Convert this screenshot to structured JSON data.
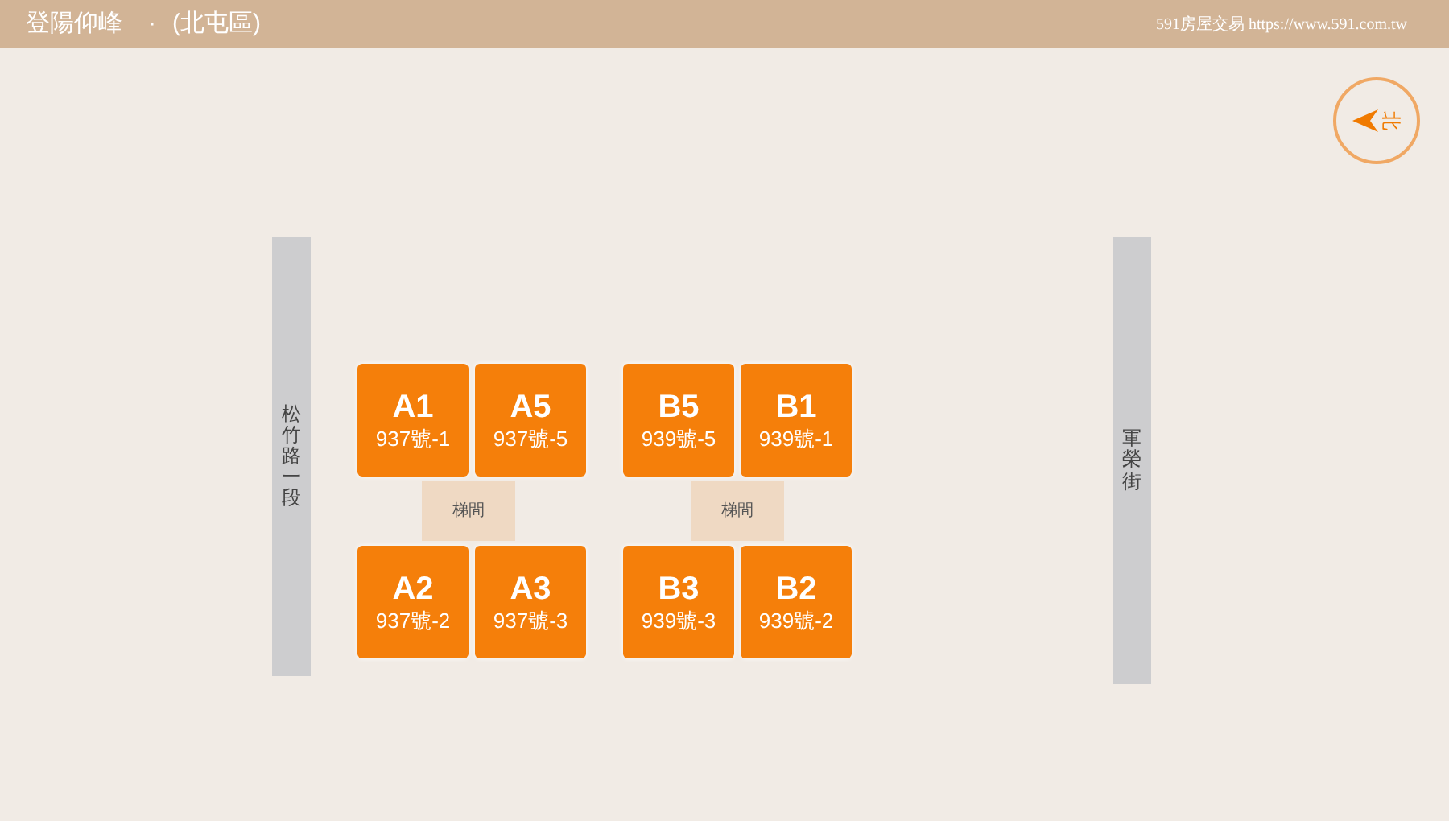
{
  "header": {
    "title": "登陽仰峰",
    "separator": "·",
    "district": "(北屯區)",
    "brand": "591房屋交易 https://www.591.com.tw"
  },
  "compass": {
    "label": "北"
  },
  "streets": [
    {
      "name": "松竹路一段"
    },
    {
      "name": "軍榮街"
    }
  ],
  "buildings": [
    {
      "top": [
        {
          "unit": "A1",
          "address": "937號-1"
        },
        {
          "unit": "A5",
          "address": "937號-5"
        }
      ],
      "stair": "梯間",
      "bottom": [
        {
          "unit": "A2",
          "address": "937號-2"
        },
        {
          "unit": "A3",
          "address": "937號-3"
        }
      ]
    },
    {
      "top": [
        {
          "unit": "B5",
          "address": "939號-5"
        },
        {
          "unit": "B1",
          "address": "939號-1"
        }
      ],
      "stair": "梯間",
      "bottom": [
        {
          "unit": "B3",
          "address": "939號-3"
        },
        {
          "unit": "B2",
          "address": "939號-2"
        }
      ]
    }
  ]
}
